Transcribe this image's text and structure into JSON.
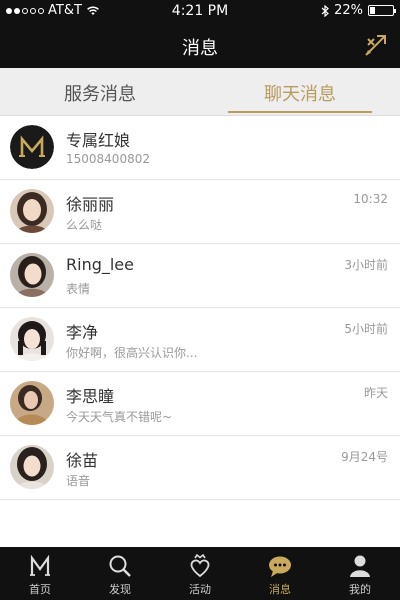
{
  "status_bar": {
    "carrier": "AT&T",
    "time": "4:21 PM",
    "battery": "22%",
    "battery_level": 0.22
  },
  "header": {
    "title": "消息",
    "action_icon": "no-match-icon"
  },
  "tabs": [
    {
      "label": "服务消息",
      "active": false
    },
    {
      "label": "聊天消息",
      "active": true
    }
  ],
  "messages": [
    {
      "name": "专属红娘",
      "preview": "15008400802",
      "time": "",
      "avatar": "logo-m"
    },
    {
      "name": "徐丽丽",
      "preview": "么么哒",
      "time": "10:32",
      "avatar": "photo"
    },
    {
      "name": "Ring_lee",
      "preview": "表情",
      "time": "3小时前",
      "avatar": "photo"
    },
    {
      "name": "李净",
      "preview": "你好啊，很高兴认识你...",
      "time": "5小时前",
      "avatar": "photo"
    },
    {
      "name": "李思瞳",
      "preview": "今天天气真不错呢~",
      "time": "昨天",
      "avatar": "photo"
    },
    {
      "name": "徐苗",
      "preview": "语音",
      "time": "9月24号",
      "avatar": "photo"
    }
  ],
  "tabbar": [
    {
      "label": "首页",
      "icon": "logo-m-icon",
      "active": false
    },
    {
      "label": "发现",
      "icon": "search-icon",
      "active": false
    },
    {
      "label": "活动",
      "icon": "heart-crown-icon",
      "active": false
    },
    {
      "label": "消息",
      "icon": "chat-bubble-icon",
      "active": true
    },
    {
      "label": "我的",
      "icon": "person-icon",
      "active": false
    }
  ],
  "colors": {
    "accent": "#b89b5e",
    "bar_bg": "#111111",
    "tab_bg": "#eeeeee"
  }
}
